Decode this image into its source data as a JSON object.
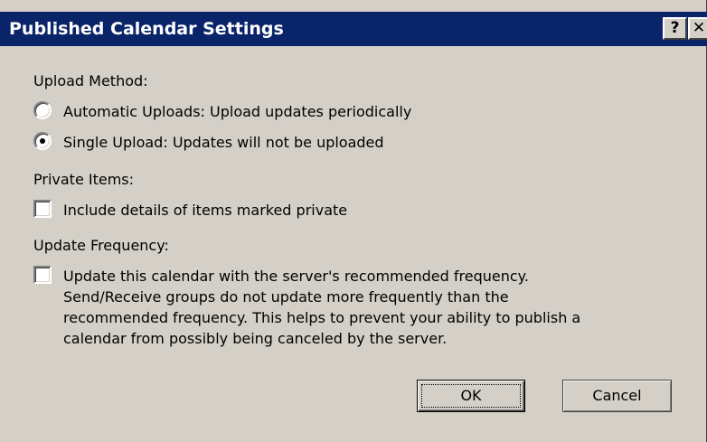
{
  "dialog": {
    "title": "Published Calendar Settings",
    "help_button": "?",
    "close_button": "✕"
  },
  "upload_method": {
    "heading": "Upload Method:",
    "options": [
      {
        "label": "Automatic Uploads: Upload updates periodically",
        "selected": false
      },
      {
        "label": "Single Upload: Updates will not be uploaded",
        "selected": true
      }
    ]
  },
  "private_items": {
    "heading": "Private Items:",
    "checkbox_label": "Include details of items marked private",
    "checked": false
  },
  "update_frequency": {
    "heading": "Update Frequency:",
    "checked": false,
    "lines": [
      "Update this calendar with the server's recommended frequency.",
      "Send/Receive groups do not update more frequently than the",
      "recommended frequency.  This helps to prevent your ability to publish a",
      "calendar from possibly being canceled by the server."
    ]
  },
  "buttons": {
    "ok": "OK",
    "cancel": "Cancel"
  },
  "colors": {
    "title_bar": "#0a246a",
    "dialog_face": "#d4d0c8"
  }
}
